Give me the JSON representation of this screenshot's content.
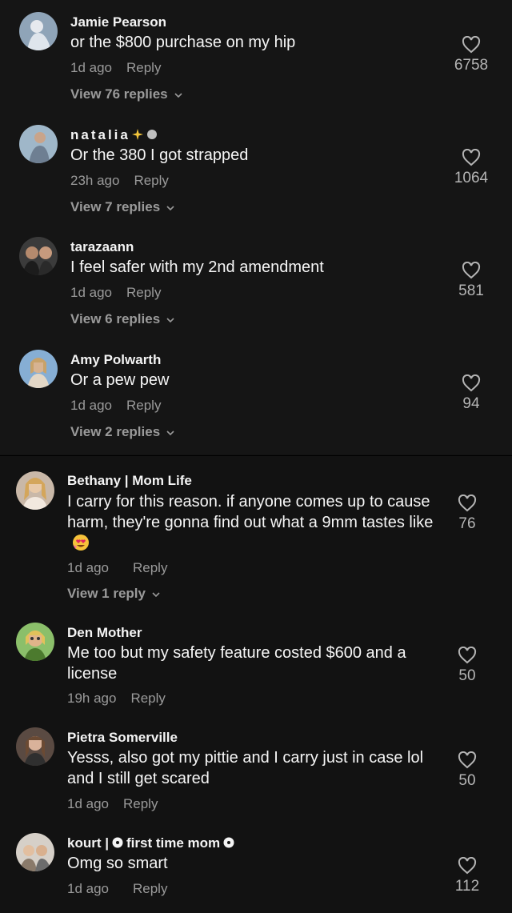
{
  "comments": [
    {
      "name": "Jamie Pearson",
      "text": "or the $800 purchase on my hip",
      "time": "1d ago",
      "reply": "Reply",
      "view": "View 76 replies",
      "likes": "6758"
    },
    {
      "name": "natalia",
      "text": "Or the 380 I got strapped",
      "time": "23h ago",
      "reply": "Reply",
      "view": "View 7 replies",
      "likes": "1064"
    },
    {
      "name": "tarazaann",
      "text": "I feel safer with my 2nd amendment",
      "time": "1d ago",
      "reply": "Reply",
      "view": "View 6 replies",
      "likes": "581"
    },
    {
      "name": "Amy Polwarth",
      "text": "Or a pew pew",
      "time": "1d ago",
      "reply": "Reply",
      "view": "View 2 replies",
      "likes": "94"
    },
    {
      "name": "Bethany | Mom Life",
      "text": "I carry for this reason. if anyone comes up to cause harm, they're gonna find out what a 9mm tastes like",
      "time": "1d ago",
      "reply": "Reply",
      "view": "View 1 reply",
      "likes": "76"
    },
    {
      "name": "Den Mother",
      "text": "Me too but my safety feature costed $600 and a license",
      "time": "19h ago",
      "reply": "Reply",
      "likes": "50"
    },
    {
      "name": "Pietra Somerville",
      "text": "Yesss, also got my pittie and I carry just in case lol and I still get scared",
      "time": "1d ago",
      "reply": "Reply",
      "likes": "50"
    },
    {
      "name_parts": [
        "kourt |",
        "first time mom"
      ],
      "text": "Omg so smart",
      "time": "1d ago",
      "reply": "Reply",
      "likes": "112"
    }
  ],
  "icons": {
    "like": "heart-outline-icon",
    "expand": "chevron-down-icon",
    "badge": "flower-badge-icon"
  }
}
